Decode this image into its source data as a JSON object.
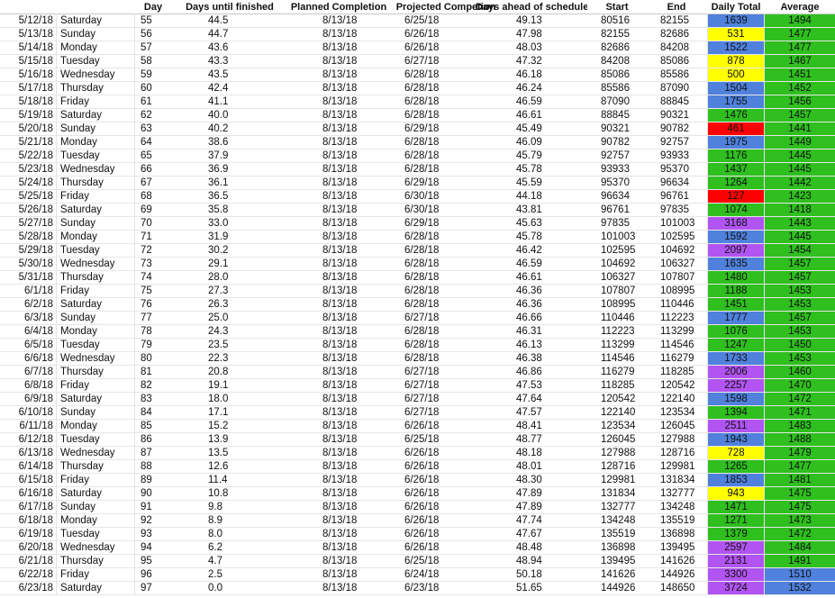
{
  "colors": {
    "green": "#2fbf1f",
    "blue": "#4f81dd",
    "yellow": "#ffff00",
    "red": "#ff0000",
    "purple": "#b154f1"
  },
  "headers": [
    "",
    "",
    "Day",
    "Days until finished",
    "Planned Completion",
    "Projected Competion",
    "Days ahead of schedule",
    "Start",
    "End",
    "Daily Total",
    "Average"
  ],
  "rows": [
    [
      "5/12/18",
      "Saturday",
      "55",
      "44.5",
      "8/13/18",
      "6/25/18",
      "49.13",
      "80516",
      "82155",
      "1639",
      "1494",
      "blue",
      "green"
    ],
    [
      "5/13/18",
      "Sunday",
      "56",
      "44.7",
      "8/13/18",
      "6/26/18",
      "47.98",
      "82155",
      "82686",
      "531",
      "1477",
      "yellow",
      "green"
    ],
    [
      "5/14/18",
      "Monday",
      "57",
      "43.6",
      "8/13/18",
      "6/26/18",
      "48.03",
      "82686",
      "84208",
      "1522",
      "1477",
      "blue",
      "green"
    ],
    [
      "5/15/18",
      "Tuesday",
      "58",
      "43.3",
      "8/13/18",
      "6/27/18",
      "47.32",
      "84208",
      "85086",
      "878",
      "1467",
      "yellow",
      "green"
    ],
    [
      "5/16/18",
      "Wednesday",
      "59",
      "43.5",
      "8/13/18",
      "6/28/18",
      "46.18",
      "85086",
      "85586",
      "500",
      "1451",
      "yellow",
      "green"
    ],
    [
      "5/17/18",
      "Thursday",
      "60",
      "42.4",
      "8/13/18",
      "6/28/18",
      "46.24",
      "85586",
      "87090",
      "1504",
      "1452",
      "blue",
      "green"
    ],
    [
      "5/18/18",
      "Friday",
      "61",
      "41.1",
      "8/13/18",
      "6/28/18",
      "46.59",
      "87090",
      "88845",
      "1755",
      "1456",
      "blue",
      "green"
    ],
    [
      "5/19/18",
      "Saturday",
      "62",
      "40.0",
      "8/13/18",
      "6/28/18",
      "46.61",
      "88845",
      "90321",
      "1476",
      "1457",
      "green",
      "green"
    ],
    [
      "5/20/18",
      "Sunday",
      "63",
      "40.2",
      "8/13/18",
      "6/29/18",
      "45.49",
      "90321",
      "90782",
      "461",
      "1441",
      "red",
      "green"
    ],
    [
      "5/21/18",
      "Monday",
      "64",
      "38.6",
      "8/13/18",
      "6/28/18",
      "46.09",
      "90782",
      "92757",
      "1975",
      "1449",
      "blue",
      "green"
    ],
    [
      "5/22/18",
      "Tuesday",
      "65",
      "37.9",
      "8/13/18",
      "6/28/18",
      "45.79",
      "92757",
      "93933",
      "1176",
      "1445",
      "green",
      "green"
    ],
    [
      "5/23/18",
      "Wednesday",
      "66",
      "36.9",
      "8/13/18",
      "6/28/18",
      "45.78",
      "93933",
      "95370",
      "1437",
      "1445",
      "green",
      "green"
    ],
    [
      "5/24/18",
      "Thursday",
      "67",
      "36.1",
      "8/13/18",
      "6/29/18",
      "45.59",
      "95370",
      "96634",
      "1264",
      "1442",
      "green",
      "green"
    ],
    [
      "5/25/18",
      "Friday",
      "68",
      "36.5",
      "8/13/18",
      "6/30/18",
      "44.18",
      "96634",
      "96761",
      "127",
      "1423",
      "red",
      "green"
    ],
    [
      "5/26/18",
      "Saturday",
      "69",
      "35.8",
      "8/13/18",
      "6/30/18",
      "43.81",
      "96761",
      "97835",
      "1074",
      "1418",
      "green",
      "green"
    ],
    [
      "5/27/18",
      "Sunday",
      "70",
      "33.0",
      "8/13/18",
      "6/29/18",
      "45.63",
      "97835",
      "101003",
      "3168",
      "1443",
      "purple",
      "green"
    ],
    [
      "5/28/18",
      "Monday",
      "71",
      "31.9",
      "8/13/18",
      "6/28/18",
      "45.78",
      "101003",
      "102595",
      "1592",
      "1445",
      "blue",
      "green"
    ],
    [
      "5/29/18",
      "Tuesday",
      "72",
      "30.2",
      "8/13/18",
      "6/28/18",
      "46.42",
      "102595",
      "104692",
      "2097",
      "1454",
      "purple",
      "green"
    ],
    [
      "5/30/18",
      "Wednesday",
      "73",
      "29.1",
      "8/13/18",
      "6/28/18",
      "46.59",
      "104692",
      "106327",
      "1635",
      "1457",
      "blue",
      "green"
    ],
    [
      "5/31/18",
      "Thursday",
      "74",
      "28.0",
      "8/13/18",
      "6/28/18",
      "46.61",
      "106327",
      "107807",
      "1480",
      "1457",
      "green",
      "green"
    ],
    [
      "6/1/18",
      "Friday",
      "75",
      "27.3",
      "8/13/18",
      "6/28/18",
      "46.36",
      "107807",
      "108995",
      "1188",
      "1453",
      "green",
      "green"
    ],
    [
      "6/2/18",
      "Saturday",
      "76",
      "26.3",
      "8/13/18",
      "6/28/18",
      "46.36",
      "108995",
      "110446",
      "1451",
      "1453",
      "green",
      "green"
    ],
    [
      "6/3/18",
      "Sunday",
      "77",
      "25.0",
      "8/13/18",
      "6/27/18",
      "46.66",
      "110446",
      "112223",
      "1777",
      "1457",
      "blue",
      "green"
    ],
    [
      "6/4/18",
      "Monday",
      "78",
      "24.3",
      "8/13/18",
      "6/28/18",
      "46.31",
      "112223",
      "113299",
      "1076",
      "1453",
      "green",
      "green"
    ],
    [
      "6/5/18",
      "Tuesday",
      "79",
      "23.5",
      "8/13/18",
      "6/28/18",
      "46.13",
      "113299",
      "114546",
      "1247",
      "1450",
      "green",
      "green"
    ],
    [
      "6/6/18",
      "Wednesday",
      "80",
      "22.3",
      "8/13/18",
      "6/28/18",
      "46.38",
      "114546",
      "116279",
      "1733",
      "1453",
      "blue",
      "green"
    ],
    [
      "6/7/18",
      "Thursday",
      "81",
      "20.8",
      "8/13/18",
      "6/27/18",
      "46.86",
      "116279",
      "118285",
      "2006",
      "1460",
      "purple",
      "green"
    ],
    [
      "6/8/18",
      "Friday",
      "82",
      "19.1",
      "8/13/18",
      "6/27/18",
      "47.53",
      "118285",
      "120542",
      "2257",
      "1470",
      "purple",
      "green"
    ],
    [
      "6/9/18",
      "Saturday",
      "83",
      "18.0",
      "8/13/18",
      "6/27/18",
      "47.64",
      "120542",
      "122140",
      "1598",
      "1472",
      "blue",
      "green"
    ],
    [
      "6/10/18",
      "Sunday",
      "84",
      "17.1",
      "8/13/18",
      "6/27/18",
      "47.57",
      "122140",
      "123534",
      "1394",
      "1471",
      "green",
      "green"
    ],
    [
      "6/11/18",
      "Monday",
      "85",
      "15.2",
      "8/13/18",
      "6/26/18",
      "48.41",
      "123534",
      "126045",
      "2511",
      "1483",
      "purple",
      "green"
    ],
    [
      "6/12/18",
      "Tuesday",
      "86",
      "13.9",
      "8/13/18",
      "6/25/18",
      "48.77",
      "126045",
      "127988",
      "1943",
      "1488",
      "blue",
      "green"
    ],
    [
      "6/13/18",
      "Wednesday",
      "87",
      "13.5",
      "8/13/18",
      "6/26/18",
      "48.18",
      "127988",
      "128716",
      "728",
      "1479",
      "yellow",
      "green"
    ],
    [
      "6/14/18",
      "Thursday",
      "88",
      "12.6",
      "8/13/18",
      "6/26/18",
      "48.01",
      "128716",
      "129981",
      "1265",
      "1477",
      "green",
      "green"
    ],
    [
      "6/15/18",
      "Friday",
      "89",
      "11.4",
      "8/13/18",
      "6/26/18",
      "48.30",
      "129981",
      "131834",
      "1853",
      "1481",
      "blue",
      "green"
    ],
    [
      "6/16/18",
      "Saturday",
      "90",
      "10.8",
      "8/13/18",
      "6/26/18",
      "47.89",
      "131834",
      "132777",
      "943",
      "1475",
      "yellow",
      "green"
    ],
    [
      "6/17/18",
      "Sunday",
      "91",
      "9.8",
      "8/13/18",
      "6/26/18",
      "47.89",
      "132777",
      "134248",
      "1471",
      "1475",
      "green",
      "green"
    ],
    [
      "6/18/18",
      "Monday",
      "92",
      "8.9",
      "8/13/18",
      "6/26/18",
      "47.74",
      "134248",
      "135519",
      "1271",
      "1473",
      "green",
      "green"
    ],
    [
      "6/19/18",
      "Tuesday",
      "93",
      "8.0",
      "8/13/18",
      "6/26/18",
      "47.67",
      "135519",
      "136898",
      "1379",
      "1472",
      "green",
      "green"
    ],
    [
      "6/20/18",
      "Wednesday",
      "94",
      "6.2",
      "8/13/18",
      "6/26/18",
      "48.48",
      "136898",
      "139495",
      "2597",
      "1484",
      "purple",
      "green"
    ],
    [
      "6/21/18",
      "Thursday",
      "95",
      "4.7",
      "8/13/18",
      "6/25/18",
      "48.94",
      "139495",
      "141626",
      "2131",
      "1491",
      "purple",
      "green"
    ],
    [
      "6/22/18",
      "Friday",
      "96",
      "2.5",
      "8/13/18",
      "6/24/18",
      "50.18",
      "141626",
      "144926",
      "3300",
      "1510",
      "purple",
      "blue"
    ],
    [
      "6/23/18",
      "Saturday",
      "97",
      "0.0",
      "8/13/18",
      "6/23/18",
      "51.65",
      "144926",
      "148650",
      "3724",
      "1532",
      "purple",
      "blue"
    ]
  ]
}
